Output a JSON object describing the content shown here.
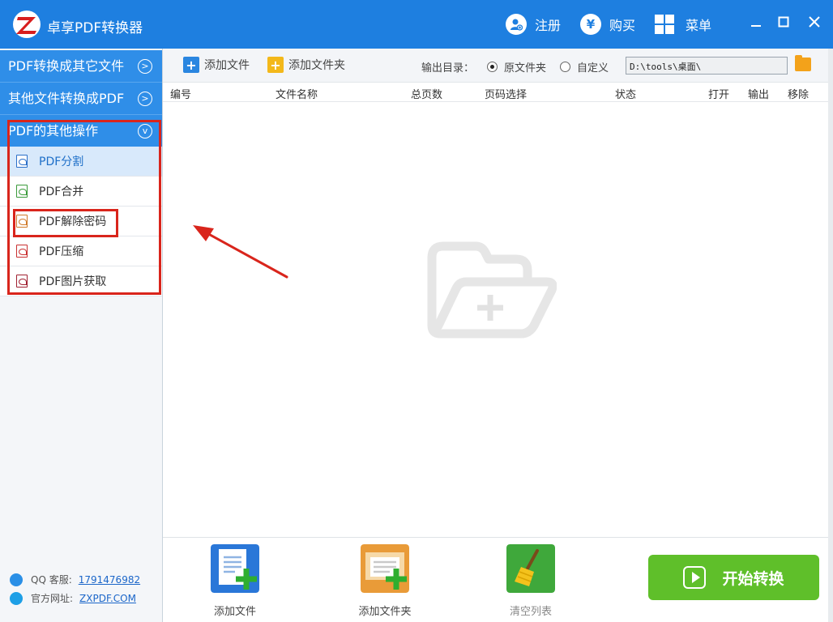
{
  "app": {
    "title": "卓享PDF转换器",
    "logo_letter": "Z"
  },
  "titlebar": {
    "register_label": "注册",
    "buy_label": "购买",
    "buy_symbol": "¥",
    "menu_label": "菜单"
  },
  "sidebar": {
    "categories": [
      {
        "label": "PDF转换成其它文件"
      },
      {
        "label": "其他文件转换成PDF"
      },
      {
        "label": "PDF的其他操作"
      }
    ],
    "subitems": [
      {
        "label": "PDF分割",
        "icon_color": "#2a6fc9"
      },
      {
        "label": "PDF合并",
        "icon_color": "#3a9a3a"
      },
      {
        "label": "PDF解除密码",
        "icon_color": "#d07a2a"
      },
      {
        "label": "PDF压缩",
        "icon_color": "#c93030"
      },
      {
        "label": "PDF图片获取",
        "icon_color": "#a02030"
      }
    ],
    "contact": {
      "qq_label": "QQ 客服:",
      "qq_value": "1791476982",
      "site_label": "官方网址:",
      "site_value": "ZXPDF.COM"
    }
  },
  "toolbar": {
    "add_file": "添加文件",
    "add_folder": "添加文件夹",
    "output_label": "输出目录：",
    "radio_original": "原文件夹",
    "radio_custom": "自定义",
    "path_value": "D:\\tools\\桌面\\"
  },
  "table": {
    "columns": [
      "编号",
      "文件名称",
      "总页数",
      "页码选择",
      "状态",
      "打开",
      "输出",
      "移除"
    ]
  },
  "bottom": {
    "add_file": "添加文件",
    "add_folder": "添加文件夹",
    "clear_list": "清空列表",
    "start": "开始转换"
  },
  "colors": {
    "brand": "#1e7fe0",
    "category": "#2f8ee8",
    "start": "#5fbf2a",
    "highlight": "#d9251c"
  }
}
